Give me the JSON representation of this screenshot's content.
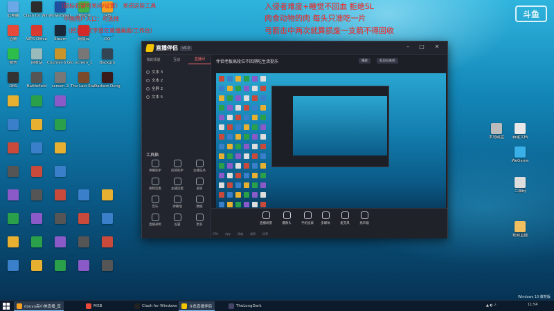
{
  "overlay": {
    "lines_left": [
      "（鼠标右键可关闭/设置）    关闭这些工具",
      "中国用户入口：可选择",
      "（把这段文字放在直播画面/工作台）"
    ],
    "lines_right": [
      "入侵者难度+睡觉不回血 拒绝SL",
      "肉食动物的肉 每头只准吃一片",
      "弓箭击中两次就算损废一支箭不得回收"
    ]
  },
  "logo": "斗鱼",
  "desktop_icons": [
    {
      "label": "此电脑",
      "color": "#6aa8e8"
    },
    {
      "label": "Clash for Windows",
      "color": "#2c2c2c"
    },
    {
      "label": "PowerShell",
      "color": "#1f4fa0"
    },
    {
      "label": "360安全",
      "color": "#3fb24a"
    },
    {
      "label": "斗鱼",
      "color": "#f5a020"
    },
    {
      "label": "谷歌",
      "color": "#e84a3a"
    },
    {
      "label": "WPS Office",
      "color": "#d93a2f"
    },
    {
      "label": "Steam",
      "color": "#1b2838"
    },
    {
      "label": "网易云",
      "color": "#d12b2b"
    },
    {
      "label": "QQ",
      "color": "#1aa3e8"
    },
    {
      "label": "微信",
      "color": "#2dbd4a"
    },
    {
      "label": "回收站",
      "color": "#9bb"
    },
    {
      "label": "Counter-S Global OR",
      "color": "#c9952a"
    },
    {
      "label": "screen_1",
      "color": "#777"
    },
    {
      "label": "Backgro",
      "color": "#345"
    },
    {
      "label": "OBS",
      "color": "#333"
    },
    {
      "label": "Battlefield",
      "color": "#555"
    },
    {
      "label": "screen_2",
      "color": "#777"
    },
    {
      "label": "The Last Stand",
      "color": "#7a4a2a"
    },
    {
      "label": "Darkest Dungeon II",
      "color": "#3a1a1a"
    }
  ],
  "right_desktop_icons": [
    {
      "label": "本地磁盘",
      "color": "#bbb"
    },
    {
      "label": "新建文档",
      "color": "#e8e8e8"
    },
    {
      "label": "WeGame",
      "color": "#3ab0e8"
    },
    {
      "label": "二维码",
      "color": "#ddd"
    },
    {
      "label": "视频直播",
      "color": "#f0c060"
    }
  ],
  "app": {
    "title": "直播伴侣",
    "version": "v5.0",
    "sidebar_tabs": [
      "我的场景",
      "互动",
      "直播间"
    ],
    "scenes": [
      "文本 3",
      "文本 2",
      "全屏 2",
      "文本 5"
    ],
    "tools_title": "工具箱",
    "tools": [
      "弹幕助手",
      "房管助手",
      "主播任务",
      "视频连麦",
      "主播连麦",
      "录屏",
      "音乐",
      "弹幕墙",
      "数据",
      "直播录制",
      "设置",
      "更多"
    ],
    "preview_title": "伴侣老板高段位不回溯吃生活挺乐",
    "chips": [
      "横屏",
      "标记已关闭"
    ],
    "bottom_tools": [
      "直播场景",
      "摄像头",
      "手机投屏",
      "多媒体",
      "麦克风",
      "扬声器"
    ],
    "status": [
      "CPU",
      "内存",
      "网络",
      "帧率",
      "码率"
    ]
  },
  "taskbar": {
    "apps": [
      {
        "label": "douyu高小美直播_直",
        "color": "#f5a020",
        "active": true
      },
      {
        "label": "MXB",
        "color": "#e84a3a",
        "active": false
      },
      {
        "label": "Clash for Windows",
        "color": "#222",
        "active": false
      },
      {
        "label": "斗鱼直播伴侣",
        "color": "#f5c400",
        "active": true
      },
      {
        "label": "TheLongDark",
        "color": "#446",
        "active": false
      }
    ],
    "time": "11:54",
    "date": "2021/1/2"
  },
  "watermark": "Windows 10 教育版"
}
